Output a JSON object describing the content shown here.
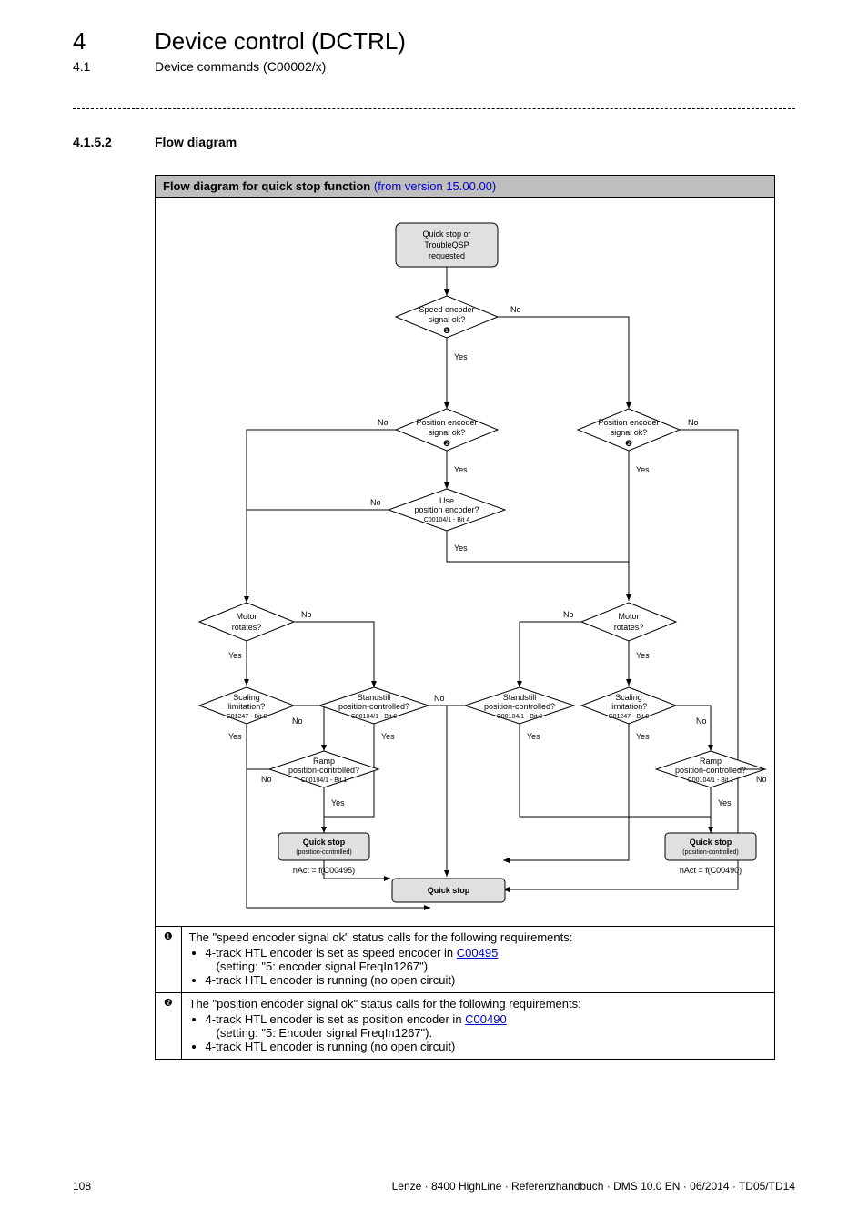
{
  "header": {
    "chapter_num": "4",
    "chapter_title": "Device control (DCTRL)",
    "section_num": "4.1",
    "section_title": "Device commands (C00002/x)"
  },
  "subsection": {
    "num": "4.1.5.2",
    "title": "Flow diagram"
  },
  "figure": {
    "title": "Flow diagram for quick stop function",
    "version": "(from version 15.00.00)"
  },
  "nodes": {
    "start": {
      "l1": "Quick stop or",
      "l2": "TroubleQSP",
      "l3": "requested"
    },
    "speed_enc": {
      "l1": "Speed encoder",
      "l2": "signal ok?",
      "note": "❶"
    },
    "pos_enc_l": {
      "l1": "Position encoder",
      "l2": "signal ok?",
      "note": "❷"
    },
    "pos_enc_r": {
      "l1": "Position encoder",
      "l2": "signal ok?",
      "note": "❷"
    },
    "use_pos": {
      "l1": "Use",
      "l2": "position encoder?",
      "sub": "C00104/1 - Bit 4"
    },
    "motor_l": {
      "l1": "Motor",
      "l2": "rotates?"
    },
    "motor_r": {
      "l1": "Motor",
      "l2": "rotates?"
    },
    "scale_l": {
      "l1": "Scaling",
      "l2": "limitation?",
      "sub": "C01247 - Bit 9"
    },
    "scale_r": {
      "l1": "Scaling",
      "l2": "limitation?",
      "sub": "C01247 - Bit 9"
    },
    "stand_l": {
      "l1": "Standstill",
      "l2": "position-controlled?",
      "sub": "C00104/1 - Bit 0"
    },
    "stand_r": {
      "l1": "Standstill",
      "l2": "position-controlled?",
      "sub": "C00104/1 - Bit 0"
    },
    "ramp_l": {
      "l1": "Ramp",
      "l2": "position-controlled?",
      "sub": "C00104/1 - Bit 1"
    },
    "ramp_r": {
      "l1": "Ramp",
      "l2": "position-controlled?",
      "sub": "C00104/1 - Bit 1"
    },
    "qs_l": {
      "l1": "Quick stop",
      "l2": "(position-controlled)"
    },
    "qs_r": {
      "l1": "Quick stop",
      "l2": "(position-controlled)"
    },
    "nact_l": "nAct = f(C00495)",
    "nact_r": "nAct = f(C00490)",
    "qs_mid": "Quick stop"
  },
  "labels": {
    "yes": "Yes",
    "no": "No"
  },
  "notes": {
    "n1_mark": "❶",
    "n1_head": "The \"speed encoder signal ok\" status calls for the following requirements:",
    "n1_b1a": "4-track HTL encoder is set as speed encoder in ",
    "n1_b1_link": "C00495",
    "n1_b1_setting": "(setting: \"5: encoder signal FreqIn1267\")",
    "n1_b2": "4-track HTL encoder is running (no open circuit)",
    "n2_mark": "❷",
    "n2_head": "The \"position encoder signal ok\" status calls for the following requirements:",
    "n2_b1a": "4-track HTL encoder is set as position encoder in ",
    "n2_b1_link": "C00490",
    "n2_b1_setting": "(setting: \"5: Encoder signal FreqIn1267\").",
    "n2_b2": "4-track HTL encoder is running (no open circuit)"
  },
  "footer": {
    "page": "108",
    "info": "Lenze · 8400 HighLine · Referenzhandbuch · DMS 10.0 EN · 06/2014 · TD05/TD14"
  }
}
